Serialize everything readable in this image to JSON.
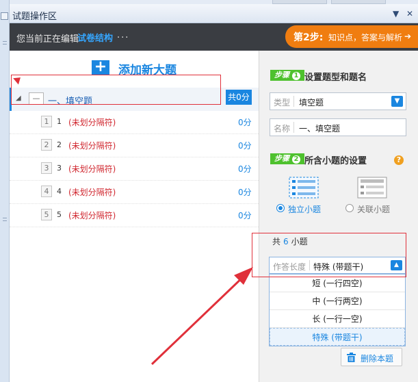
{
  "panel": {
    "title": "试题操作区",
    "pin_glyph": "▼",
    "close_glyph": "✕"
  },
  "edit_bar": {
    "editing_text": "您当前正在编辑",
    "structure_link": "试卷结构",
    "dots": "...",
    "step_big": "第2步:",
    "step_small": "知识点，答案与解析",
    "step_arrow": "➔"
  },
  "left": {
    "add_label": "添加新大题",
    "add_glyph": "+",
    "section": {
      "arrow": "◢",
      "box_glyph": "—",
      "label": "一、填空题",
      "score": "共0分"
    },
    "questions": [
      {
        "box": "1",
        "num": "1",
        "sep": "(未划分隔符)",
        "score": "0分"
      },
      {
        "box": "2",
        "num": "2",
        "sep": "(未划分隔符)",
        "score": "0分"
      },
      {
        "box": "3",
        "num": "3",
        "sep": "(未划分隔符)",
        "score": "0分"
      },
      {
        "box": "4",
        "num": "4",
        "sep": "(未划分隔符)",
        "score": "0分"
      },
      {
        "box": "5",
        "num": "5",
        "sep": "(未划分隔符)",
        "score": "0分"
      }
    ]
  },
  "right": {
    "step1": {
      "badge": "步骤",
      "num": "1",
      "heading": "设置题型和题名"
    },
    "type_field": {
      "label": "类型",
      "value": "填空题",
      "dd_glyph": "▼"
    },
    "name_field": {
      "label": "名称",
      "value": "一、填空题"
    },
    "step2": {
      "badge": "步骤",
      "num": "2",
      "heading": "所含小题的设置",
      "help": "?"
    },
    "radios": {
      "independent": "独立小题",
      "linked": "关联小题"
    },
    "count": {
      "prefix": "共",
      "value": "6",
      "suffix": "小题"
    },
    "answer": {
      "label": "作答长度",
      "value": "特殊 (带题干)",
      "dd_glyph": "▲"
    },
    "options": [
      "短 (一行四空)",
      "中 (一行两空)",
      "长 (一行一空)",
      "特殊 (带题干)"
    ],
    "delete_label": "删除本题"
  },
  "colors": {
    "accent": "#1a86e0",
    "step_orange": "#f07d10",
    "badge_green": "#4ec12e",
    "highlight_red": "#e0303a"
  }
}
